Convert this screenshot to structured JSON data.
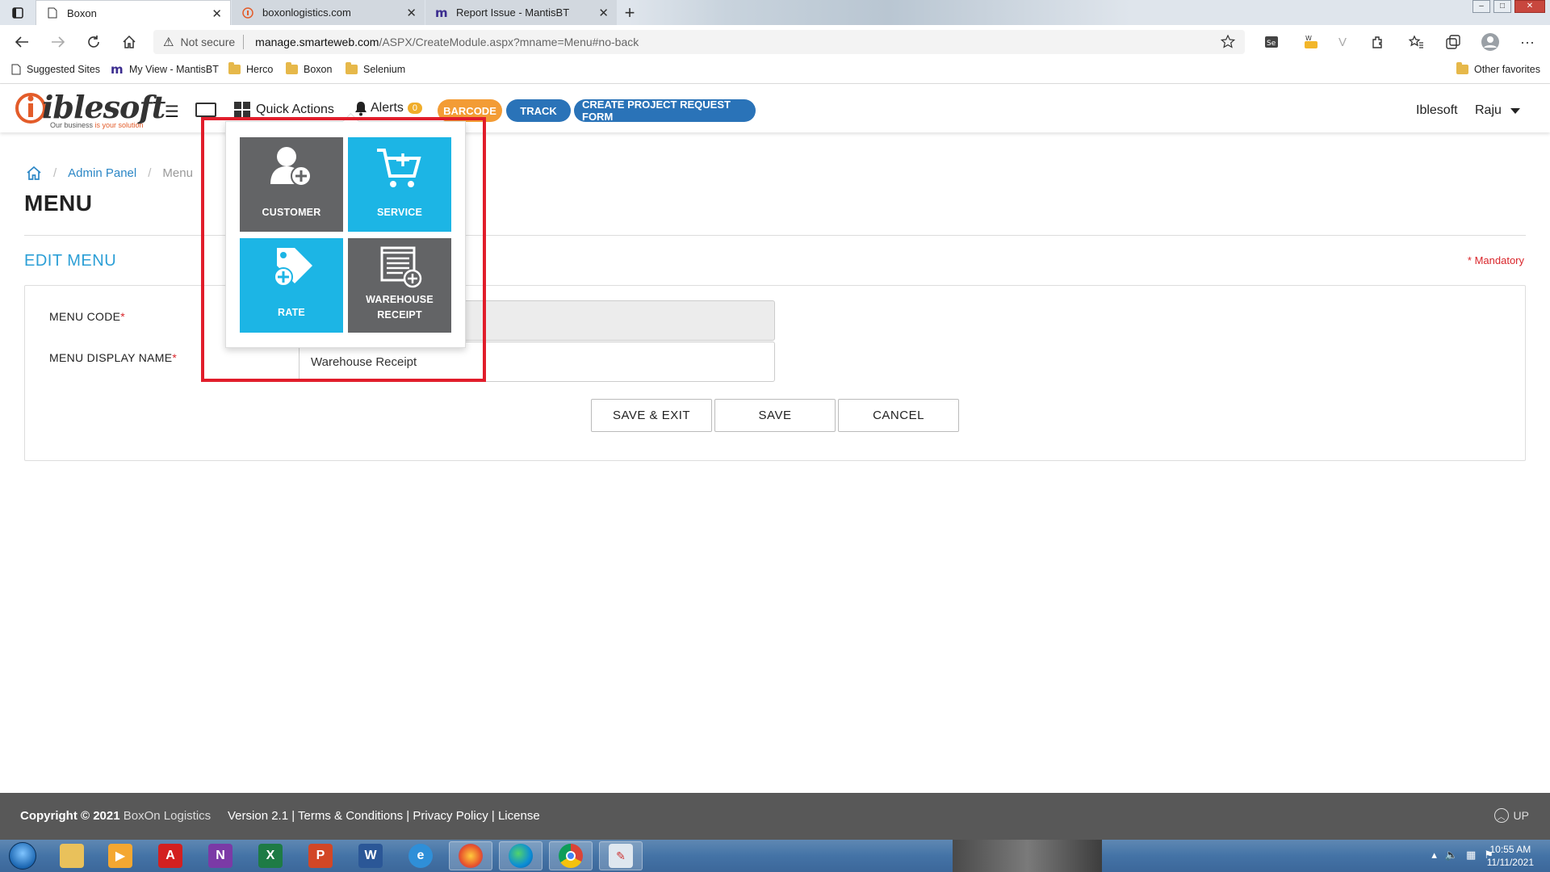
{
  "browser": {
    "tabs": [
      {
        "title": "Boxon",
        "active": true
      },
      {
        "title": "boxonlogistics.com",
        "active": false
      },
      {
        "title": "Report Issue - MantisBT",
        "active": false
      }
    ],
    "new_tab_label": "+",
    "security_label": "Not secure",
    "url_host": "manage.smarteweb.com",
    "url_path": "/ASPX/CreateModule.aspx?mname=Menu#no-back",
    "bookmarks": [
      {
        "label": "Suggested Sites",
        "icon": "page-icon"
      },
      {
        "label": "My View - MantisBT",
        "icon": "mantis-icon"
      },
      {
        "label": "Herco",
        "icon": "folder-icon"
      },
      {
        "label": "Boxon",
        "icon": "folder-icon"
      },
      {
        "label": "Selenium",
        "icon": "folder-icon"
      }
    ],
    "other_favorites": "Other favorites"
  },
  "header": {
    "logo_text": "iblesoft",
    "logo_tagline_a": "Our business ",
    "logo_tagline_b": "is your solution",
    "quick_actions_label": "Quick Actions",
    "alerts_label": "Alerts",
    "alerts_count": "0",
    "barcode_label": "BARCODE",
    "track_label": "TRACK",
    "project_form_label": "CREATE PROJECT REQUEST FORM",
    "company": "Iblesoft",
    "user": "Raju",
    "colors": {
      "barcode": "#f39c35",
      "track": "#2a73b8",
      "project": "#2a73b8"
    }
  },
  "breadcrumb": {
    "item1": "Admin Panel",
    "item2": "Menu"
  },
  "page": {
    "title": "MENU",
    "section_title": "EDIT MENU",
    "mandatory_note": "* Mandatory",
    "fields": {
      "menu_code_label": "MENU CODE",
      "menu_code_value": "",
      "display_name_label": "MENU DISPLAY NAME",
      "display_name_value": "Warehouse Receipt",
      "required_mark": "*"
    },
    "buttons": {
      "save_exit": "SAVE & EXIT",
      "save": "SAVE",
      "cancel": "CANCEL"
    }
  },
  "quick_actions": {
    "tiles": [
      {
        "label": "CUSTOMER",
        "icon": "add-user-icon",
        "color": "#636466"
      },
      {
        "label": "SERVICE",
        "icon": "add-cart-icon",
        "color": "#1cb5e5"
      },
      {
        "label": "RATE",
        "icon": "add-tag-icon",
        "color": "#1cb5e5"
      },
      {
        "label_line1": "WAREHOUSE",
        "label_line2": "RECEIPT",
        "icon": "add-document-icon",
        "color": "#636466"
      }
    ]
  },
  "footer": {
    "copyright": "Copyright © 2021",
    "company": "BoxOn Logistics",
    "version": "Version 2.1",
    "terms": "Terms & Conditions",
    "privacy": "Privacy Policy",
    "license": "License",
    "separator": "|",
    "up_label": "UP"
  },
  "taskbar": {
    "time": "10:55 AM",
    "date": "11/11/2021"
  }
}
